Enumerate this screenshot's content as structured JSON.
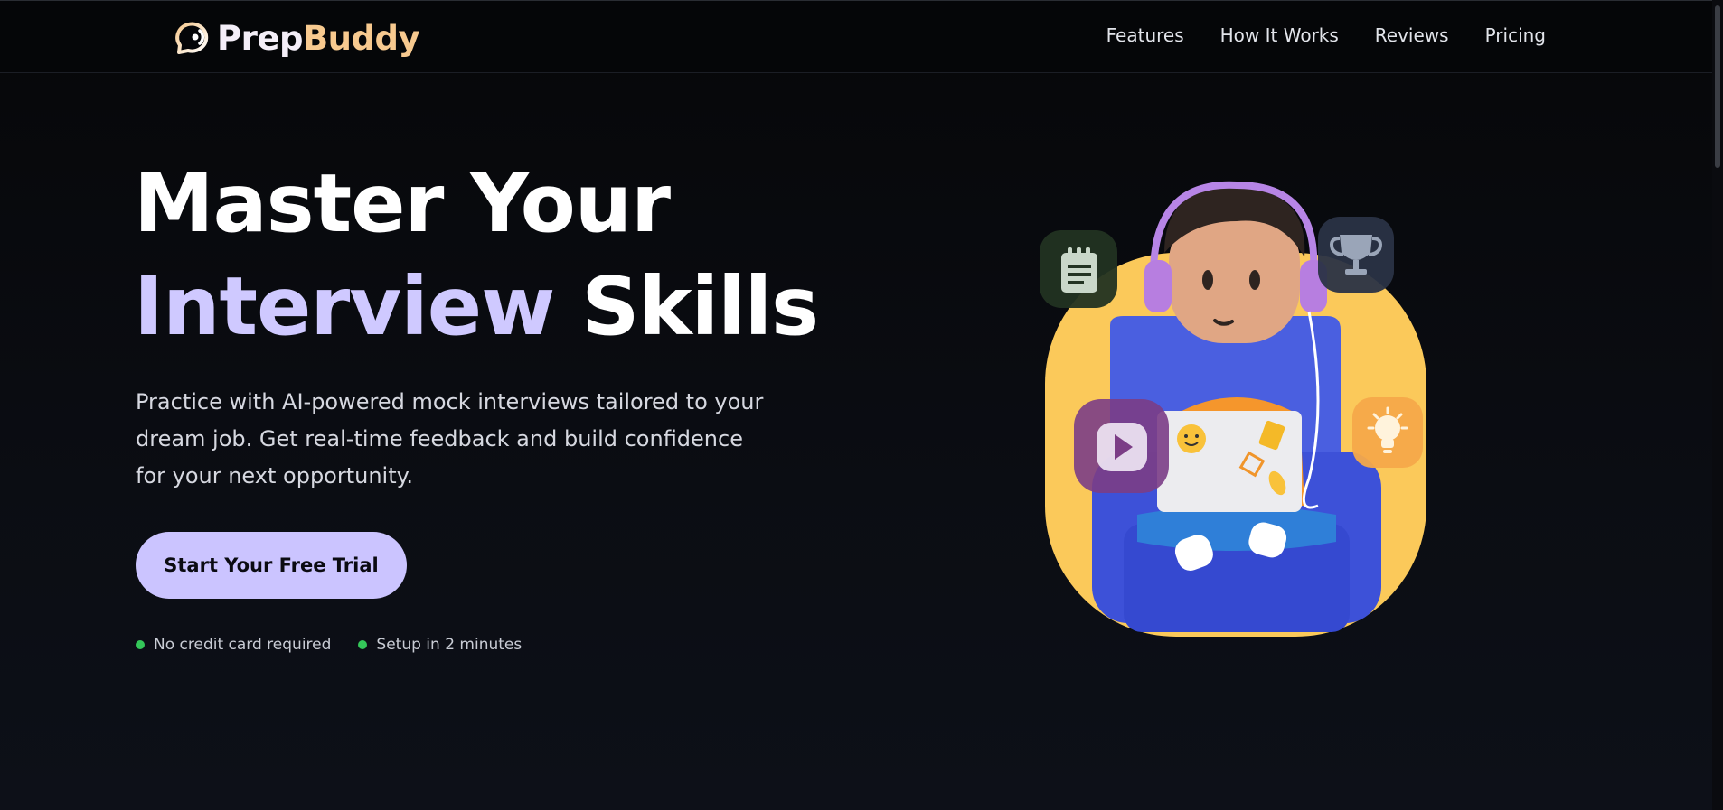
{
  "brand": {
    "name_part1": "Prep",
    "name_part2": "Buddy",
    "accent": "#f7c98f"
  },
  "nav": {
    "links": [
      {
        "label": "Features"
      },
      {
        "label": "How It Works"
      },
      {
        "label": "Reviews"
      },
      {
        "label": "Pricing"
      }
    ]
  },
  "hero": {
    "title_line1": "Master Your",
    "title_highlight": "Interview",
    "title_rest": " Skills",
    "subtitle": "Practice with AI-powered mock interviews tailored to your dream job. Get real-time feedback and build confidence for your next opportunity.",
    "cta_label": "Start Your Free Trial",
    "perks": [
      "No credit card required",
      "Setup in 2 minutes"
    ]
  },
  "colors": {
    "highlight": "#cfc9ff",
    "cta_bg": "#cbc4ff",
    "perk_dot": "#34c759",
    "illustration_bg": "#fbc95a"
  },
  "illustration_icons": [
    "notepad-icon",
    "trophy-icon",
    "play-icon",
    "lightbulb-icon"
  ]
}
